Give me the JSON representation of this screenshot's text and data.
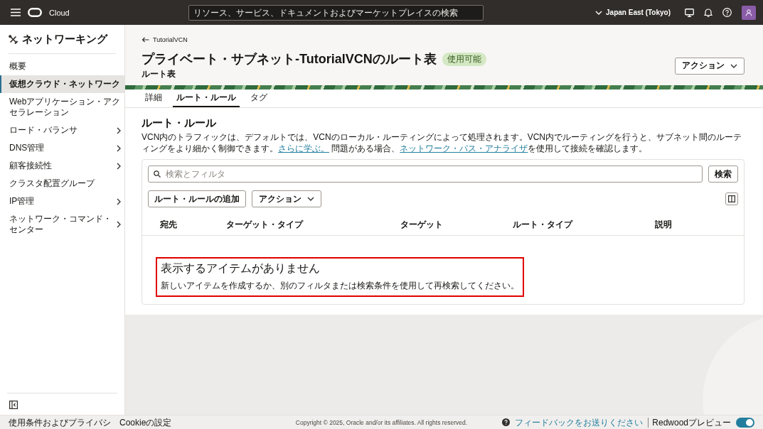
{
  "top_bar": {
    "product": "Cloud",
    "search_placeholder": "リソース、サービス、ドキュメントおよびマーケットプレイスの検索",
    "region": "Japan East (Tokyo)"
  },
  "sidebar": {
    "title": "ネットワーキング",
    "items": [
      {
        "label": "概要",
        "selected": false,
        "submenu": false
      },
      {
        "label": "仮想クラウド・ネットワーク",
        "selected": true,
        "submenu": false
      },
      {
        "label": "Webアプリケーション・アクセラレーション",
        "selected": false,
        "submenu": false
      },
      {
        "label": "ロード・バランサ",
        "selected": false,
        "submenu": true
      },
      {
        "label": "DNS管理",
        "selected": false,
        "submenu": true
      },
      {
        "label": "顧客接続性",
        "selected": false,
        "submenu": true
      },
      {
        "label": "クラスタ配置グループ",
        "selected": false,
        "submenu": false
      },
      {
        "label": "IP管理",
        "selected": false,
        "submenu": true
      },
      {
        "label": "ネットワーク・コマンド・センター",
        "selected": false,
        "submenu": true
      }
    ]
  },
  "header": {
    "back_link": "TutorialVCN",
    "title": "プライベート・サブネット-TutorialVCNのルート表",
    "status_badge": "使用可能",
    "subtitle": "ルート表",
    "actions_button": "アクション"
  },
  "tabs": [
    {
      "label": "詳細",
      "selected": false
    },
    {
      "label": "ルート・ルール",
      "selected": true
    },
    {
      "label": "タグ",
      "selected": false
    }
  ],
  "section": {
    "title": "ルート・ルール",
    "description": [
      {
        "kind": "text",
        "text": "VCN内のトラフィックは、デフォルトでは、VCNのローカル・ルーティングによって処理されます。VCN内でルーティングを行うと、サブネット間のルーティングをより細かく制御できます。"
      },
      {
        "kind": "link",
        "text": "さらに学ぶ。"
      },
      {
        "kind": "text",
        "text": " 問題がある場合、"
      },
      {
        "kind": "link",
        "text": "ネットワーク・パス・アナライザ"
      },
      {
        "kind": "text",
        "text": "を使用して接続を確認します。"
      }
    ]
  },
  "table": {
    "search_placeholder": "検索とフィルタ",
    "search_button": "検索",
    "add_button": "ルート・ルールの追加",
    "actions_button": "アクション",
    "columns": [
      "宛先",
      "ターゲット・タイプ",
      "ターゲット",
      "ルート・タイプ",
      "説明"
    ],
    "empty_state": {
      "title": "表示するアイテムがありません",
      "message": "新しいアイテムを作成するか、別のフィルタまたは検索条件を使用して再検索してください。",
      "highlighted": true
    }
  },
  "footer": {
    "links": [
      "使用条件およびプライバシ",
      "Cookieの設定"
    ],
    "copyright": "Copyright © 2025, Oracle and/or its affiliates. All rights reserved.",
    "feedback_link": "フィードバックをお送りください",
    "preview_label": "Redwoodプレビュー",
    "preview_toggle": {
      "on": true
    }
  }
}
